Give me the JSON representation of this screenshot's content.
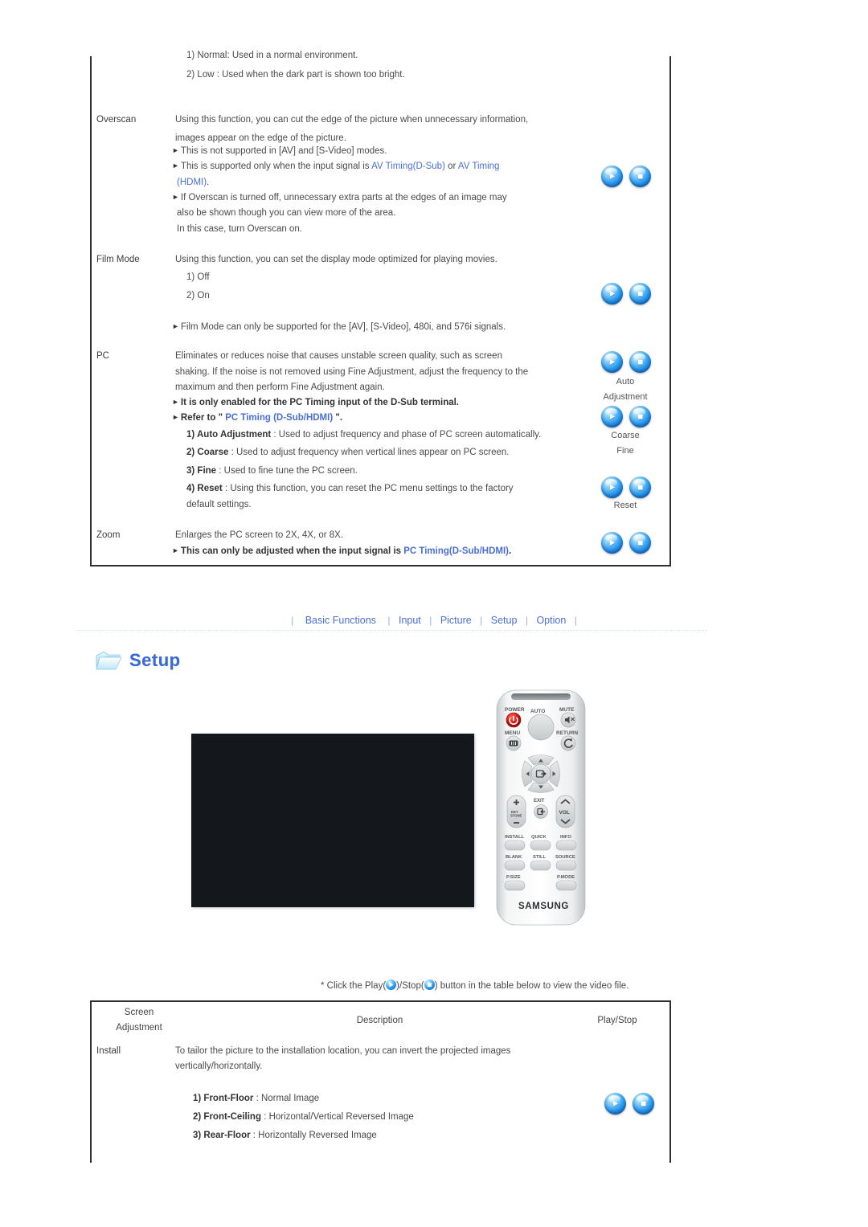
{
  "top_panel": {
    "intro_items": [
      "1) Normal: Used in a normal environment.",
      "2) Low : Used when the dark part is shown too bright."
    ],
    "rows": [
      {
        "label": "Overscan",
        "lines": [
          {
            "type": "plain",
            "text": "Using this function, you can cut the edge of the picture when unnecessary information,"
          },
          {
            "type": "plain",
            "text": "images appear on the edge of the picture."
          },
          {
            "type": "bullet",
            "text": "This is not supported in [AV] and [S-Video] modes."
          },
          {
            "type": "bullet_mixed",
            "pre": "This is supported only when the input signal is ",
            "link1": "AV Timing(D-Sub)",
            "mid": " or ",
            "link2": "AV Timing"
          },
          {
            "type": "link_only",
            "text": "(HDMI)",
            "tail": "."
          },
          {
            "type": "bullet",
            "text": "If Overscan is turned off, unnecessary extra parts at the edges of an image may"
          },
          {
            "type": "plain",
            "text": "also be shown though you can view more of the area."
          },
          {
            "type": "plain",
            "text": "In this case, turn Overscan on."
          }
        ]
      },
      {
        "label": "Film Mode",
        "lines": [
          {
            "type": "plain",
            "text": "Using this function, you can set the display mode optimized for playing movies."
          },
          {
            "type": "indent",
            "text": "1) Off"
          },
          {
            "type": "indent",
            "text": "2) On"
          },
          {
            "type": "bullet",
            "text": "Film Mode can only be supported for the [AV], [S-Video], 480i, and 576i signals."
          }
        ]
      },
      {
        "label": "PC",
        "lines": [
          {
            "type": "plain",
            "text": "Eliminates or reduces noise that causes unstable screen quality, such as screen"
          },
          {
            "type": "plain",
            "text": "shaking. If the noise is not removed using Fine Adjustment, adjust the frequency to the"
          },
          {
            "type": "plain",
            "text": "maximum and then perform Fine Adjustment again."
          },
          {
            "type": "bullet_bold",
            "text": "It is only enabled for the PC Timing input of the D-Sub terminal."
          },
          {
            "type": "refer",
            "pre": "Refer to \" ",
            "link": "PC Timing (D-Sub/HDMI)",
            "post": " \"."
          },
          {
            "type": "numbered",
            "num": "1) Auto Adjustment",
            "sep": " : ",
            "desc": "Used to adjust frequency and phase of PC screen automatically."
          },
          {
            "type": "numbered",
            "num": "2) Coarse",
            "sep": " : ",
            "desc": "Used to adjust frequency when vertical lines appear on PC screen."
          },
          {
            "type": "numbered",
            "num": "3) Fine",
            "sep": " : ",
            "desc": "Used to fine tune the PC screen."
          },
          {
            "type": "numbered",
            "num": "4) Reset",
            "sep": " : ",
            "desc": "Using this function, you can reset the PC menu settings to the factory"
          },
          {
            "type": "indent",
            "text": "default settings."
          }
        ]
      },
      {
        "label": "Zoom",
        "lines": [
          {
            "type": "plain",
            "text": "Enlarges the PC screen to 2X, 4X, or 8X."
          },
          {
            "type": "bullet_link",
            "pre": "This can only be adjusted when the input signal is ",
            "link": "PC Timing(D-Sub/HDMI)",
            "post": "."
          }
        ]
      }
    ],
    "side_labels": [
      {
        "text": "Auto"
      },
      {
        "text": "Adjustment"
      },
      {
        "text": "Coarse"
      },
      {
        "text": "Fine"
      },
      {
        "text": "Reset"
      }
    ]
  },
  "navbar": {
    "items": [
      "Basic Functions",
      "Input",
      "Picture",
      "Setup",
      "Option"
    ],
    "separator": "|"
  },
  "setup_section": {
    "title": "Setup",
    "folder_icon": "folder-icon"
  },
  "media": {
    "video_placeholder": "video-player",
    "remote_image": "samsung-remote-control",
    "remote_brand": "SAMSUNG",
    "remote_buttons": [
      "POWER",
      "AUTO",
      "MUTE",
      "MENU",
      "RETURN",
      "EXIT",
      "VOL",
      "KEYSTONE",
      "INSTALL",
      "QUICK",
      "INFO",
      "BLANK",
      "STILL",
      "SOURCE",
      "P.SIZE",
      "P.MODE"
    ]
  },
  "note": {
    "prefix": "* Click the Play(",
    "middle": ")/Stop(",
    "suffix": ") button in the table below to view the video file."
  },
  "bottom_table": {
    "headers": {
      "col1_line1": "Screen",
      "col1_line2": "Adjustment",
      "col2": "Description",
      "col3": "Play/Stop"
    },
    "rows": [
      {
        "label": "Install",
        "lines": [
          {
            "type": "plain",
            "text": "To tailor the picture to the installation location, you can invert the projected images"
          },
          {
            "type": "plain",
            "text": "vertically/horizontally."
          },
          {
            "type": "numbered",
            "num": "1) Front-Floor",
            "sep": " : ",
            "desc": "Normal Image"
          },
          {
            "type": "numbered",
            "num": "2) Front-Ceiling",
            "sep": " : ",
            "desc": "Horizontal/Vertical Reversed Image"
          },
          {
            "type": "numbered",
            "num": "3) Rear-Floor",
            "sep": " : ",
            "desc": "Horizontally Reversed Image"
          }
        ]
      }
    ]
  },
  "colors": {
    "link_blue": "#4a6fd4",
    "text_gray": "#4a4a4a",
    "border_dark": "#2f2f2f",
    "button_blue": "#2f9ff0",
    "video_bg": "#14171c"
  }
}
